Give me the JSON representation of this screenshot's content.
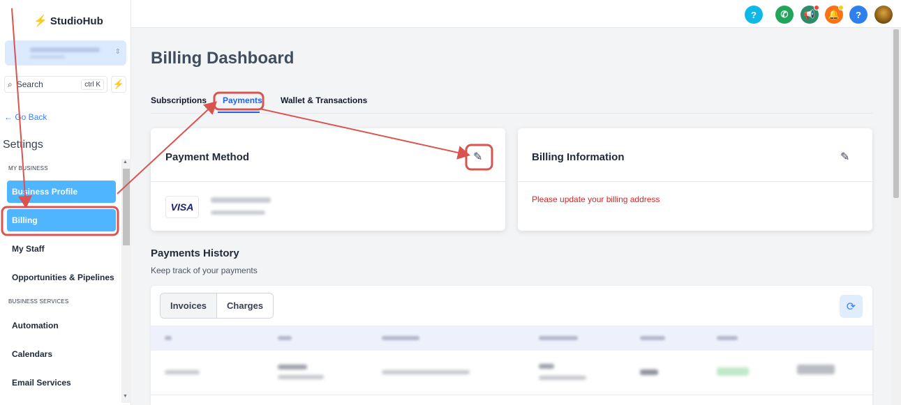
{
  "brand": {
    "name": "StudioHub"
  },
  "sidebar": {
    "search_placeholder": "Search",
    "search_shortcut": "ctrl K",
    "go_back": "Go Back",
    "title": "Settings",
    "sections": [
      {
        "label": "MY BUSINESS"
      },
      {
        "label": "BUSINESS SERVICES"
      }
    ],
    "items": [
      {
        "label": "Business Profile"
      },
      {
        "label": "Billing"
      },
      {
        "label": "My Staff"
      },
      {
        "label": "Opportunities & Pipelines"
      },
      {
        "label": "Automation"
      },
      {
        "label": "Calendars"
      },
      {
        "label": "Email Services"
      }
    ]
  },
  "topbar": {
    "icons": [
      "help-icon",
      "phone-icon",
      "megaphone-icon",
      "bell-icon",
      "help-icon",
      "avatar"
    ],
    "colors": [
      "#0fb8e6",
      "#22a55a",
      "#2f8c6a",
      "#f97316",
      "#2f80ed"
    ]
  },
  "main": {
    "title": "Billing Dashboard",
    "tabs": [
      {
        "label": "Subscriptions"
      },
      {
        "label": "Payments"
      },
      {
        "label": "Wallet & Transactions"
      }
    ],
    "payment_method": {
      "title": "Payment Method",
      "brand": "VISA"
    },
    "billing_info": {
      "title": "Billing Information",
      "warning": "Please update your billing address"
    },
    "history": {
      "title": "Payments History",
      "subtitle": "Keep track of your payments",
      "segments": [
        {
          "label": "Invoices"
        },
        {
          "label": "Charges"
        }
      ]
    }
  },
  "annotation_color": "#d9534f"
}
